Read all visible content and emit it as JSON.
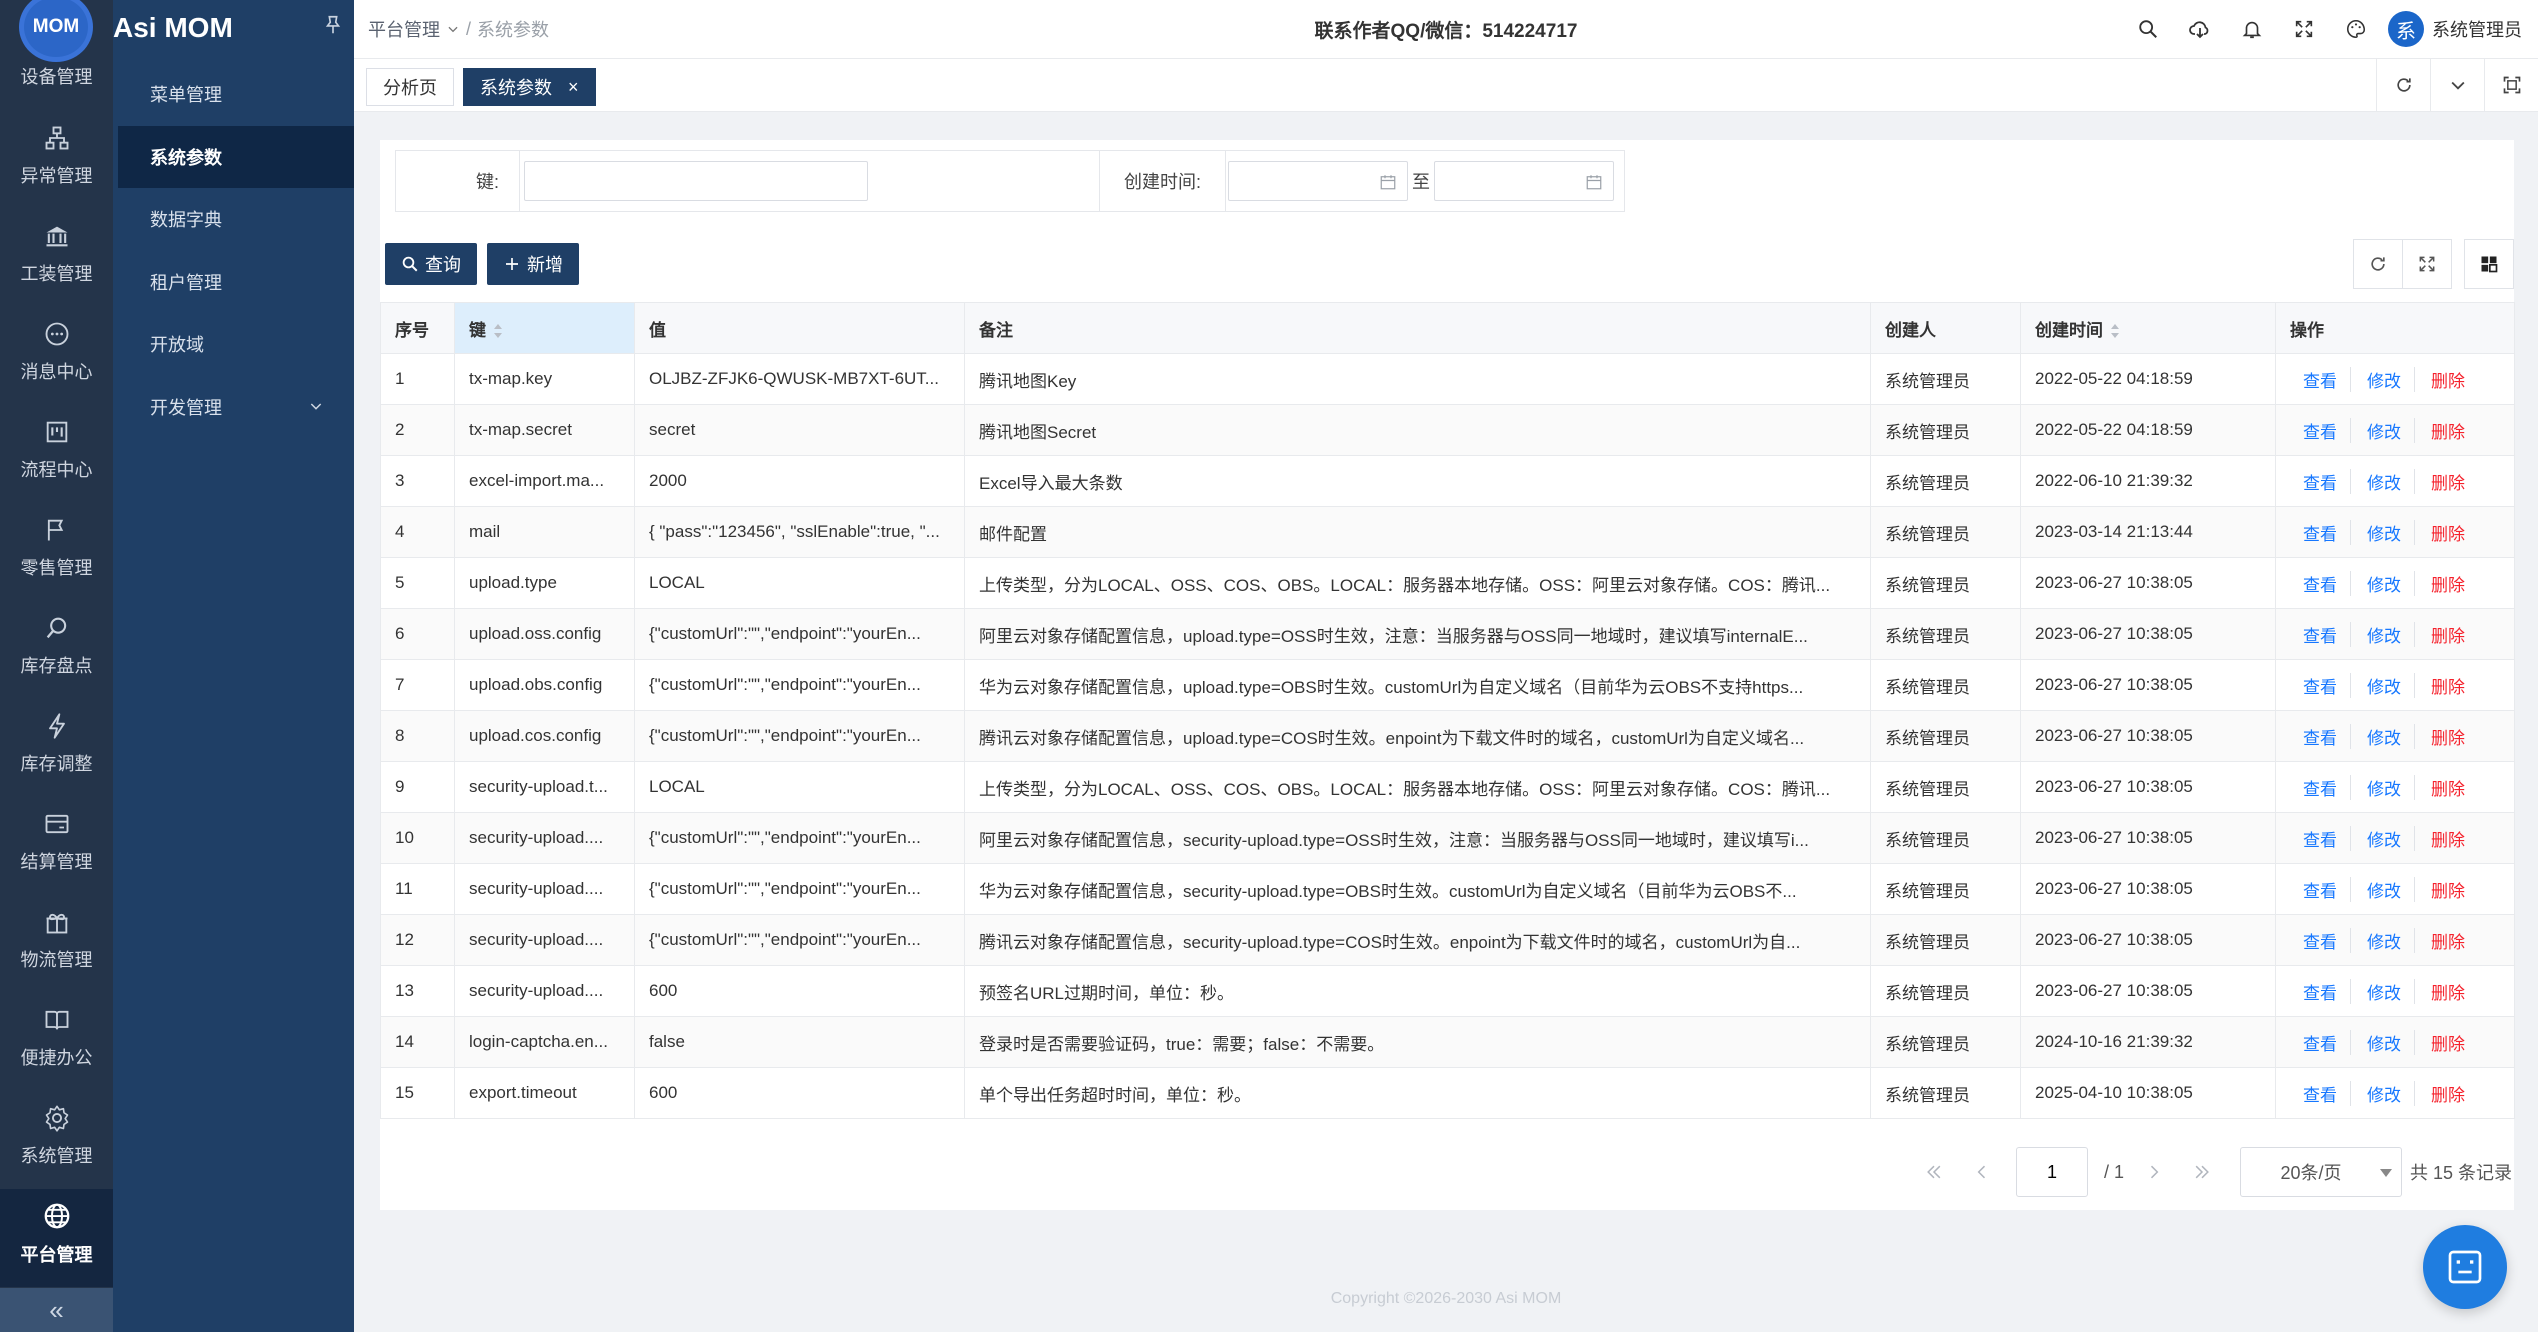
{
  "app": {
    "logo_text": "MOM",
    "title": "Asi MOM"
  },
  "rail": {
    "items": [
      {
        "label": "设备管理",
        "icon": "device-icon"
      },
      {
        "label": "异常管理",
        "icon": "sitemap-icon"
      },
      {
        "label": "工装管理",
        "icon": "bank-icon"
      },
      {
        "label": "消息中心",
        "icon": "message-icon"
      },
      {
        "label": "流程中心",
        "icon": "kanban-icon"
      },
      {
        "label": "零售管理",
        "icon": "flag-icon"
      },
      {
        "label": "库存盘点",
        "icon": "search-icon"
      },
      {
        "label": "库存调整",
        "icon": "lightning-icon"
      },
      {
        "label": "结算管理",
        "icon": "card-icon"
      },
      {
        "label": "物流管理",
        "icon": "gift-icon"
      },
      {
        "label": "便捷办公",
        "icon": "book-icon"
      },
      {
        "label": "系统管理",
        "icon": "gear-icon"
      },
      {
        "label": "平台管理",
        "icon": "globe-icon"
      }
    ],
    "collapse": "«"
  },
  "submenu": {
    "items": [
      {
        "label": "菜单管理"
      },
      {
        "label": "系统参数"
      },
      {
        "label": "数据字典"
      },
      {
        "label": "租户管理"
      },
      {
        "label": "开放域"
      },
      {
        "label": "开发管理"
      }
    ]
  },
  "header": {
    "crumb1": "平台管理",
    "crumb2": "系统参数",
    "notice": "联系作者QQ/微信：514224717",
    "user": "系统管理员",
    "avatar": "系"
  },
  "tabs": [
    {
      "label": "分析页"
    },
    {
      "label": "系统参数",
      "close": "×"
    }
  ],
  "search": {
    "key_label": "键:",
    "key_value": "",
    "time_label": "创建时间:",
    "to": "至"
  },
  "toolbar": {
    "query": "查询",
    "add": "新增"
  },
  "table": {
    "columns": [
      "序号",
      "键",
      "值",
      "备注",
      "创建人",
      "创建时间",
      "操作"
    ],
    "actions": [
      "查看",
      "修改",
      "删除"
    ],
    "rows": [
      [
        "1",
        "tx-map.key",
        "OLJBZ-ZFJK6-QWUSK-MB7XT-6UT...",
        "腾讯地图Key",
        "系统管理员",
        "2022-05-22 04:18:59"
      ],
      [
        "2",
        "tx-map.secret",
        "secret",
        "腾讯地图Secret",
        "系统管理员",
        "2022-05-22 04:18:59"
      ],
      [
        "3",
        "excel-import.ma...",
        "2000",
        "Excel导入最大条数",
        "系统管理员",
        "2022-06-10 21:39:32"
      ],
      [
        "4",
        "mail",
        "{ \"pass\":\"123456\", \"sslEnable\":true, \"...",
        "邮件配置",
        "系统管理员",
        "2023-03-14 21:13:44"
      ],
      [
        "5",
        "upload.type",
        "LOCAL",
        "上传类型，分为LOCAL、OSS、COS、OBS。LOCAL：服务器本地存储。OSS：阿里云对象存储。COS：腾讯...",
        "系统管理员",
        "2023-06-27 10:38:05"
      ],
      [
        "6",
        "upload.oss.config",
        "{\"customUrl\":\"\",\"endpoint\":\"yourEn...",
        "阿里云对象存储配置信息，upload.type=OSS时生效，注意：当服务器与OSS同一地域时，建议填写internalE...",
        "系统管理员",
        "2023-06-27 10:38:05"
      ],
      [
        "7",
        "upload.obs.config",
        "{\"customUrl\":\"\",\"endpoint\":\"yourEn...",
        "华为云对象存储配置信息，upload.type=OBS时生效。customUrl为自定义域名（目前华为云OBS不支持https...",
        "系统管理员",
        "2023-06-27 10:38:05"
      ],
      [
        "8",
        "upload.cos.config",
        "{\"customUrl\":\"\",\"endpoint\":\"yourEn...",
        "腾讯云对象存储配置信息，upload.type=COS时生效。enpoint为下载文件时的域名，customUrl为自定义域名...",
        "系统管理员",
        "2023-06-27 10:38:05"
      ],
      [
        "9",
        "security-upload.t...",
        "LOCAL",
        "上传类型，分为LOCAL、OSS、COS、OBS。LOCAL：服务器本地存储。OSS：阿里云对象存储。COS：腾讯...",
        "系统管理员",
        "2023-06-27 10:38:05"
      ],
      [
        "10",
        "security-upload....",
        "{\"customUrl\":\"\",\"endpoint\":\"yourEn...",
        "阿里云对象存储配置信息，security-upload.type=OSS时生效，注意：当服务器与OSS同一地域时，建议填写i...",
        "系统管理员",
        "2023-06-27 10:38:05"
      ],
      [
        "11",
        "security-upload....",
        "{\"customUrl\":\"\",\"endpoint\":\"yourEn...",
        "华为云对象存储配置信息，security-upload.type=OBS时生效。customUrl为自定义域名（目前华为云OBS不...",
        "系统管理员",
        "2023-06-27 10:38:05"
      ],
      [
        "12",
        "security-upload....",
        "{\"customUrl\":\"\",\"endpoint\":\"yourEn...",
        "腾讯云对象存储配置信息，security-upload.type=COS时生效。enpoint为下载文件时的域名，customUrl为自...",
        "系统管理员",
        "2023-06-27 10:38:05"
      ],
      [
        "13",
        "security-upload....",
        "600",
        "预签名URL过期时间，单位：秒。",
        "系统管理员",
        "2023-06-27 10:38:05"
      ],
      [
        "14",
        "login-captcha.en...",
        "false",
        "登录时是否需要验证码，true：需要；false：不需要。",
        "系统管理员",
        "2024-10-16 21:39:32"
      ],
      [
        "15",
        "export.timeout",
        "600",
        "单个导出任务超时时间，单位：秒。",
        "系统管理员",
        "2025-04-10 10:38:05"
      ]
    ]
  },
  "pager": {
    "page": "1",
    "total_pages": "/ 1",
    "page_size": "20条/页",
    "total": "共 15 条记录"
  },
  "footer": "Copyright ©2026-2030 Asi MOM",
  "colors": {
    "primary": "#1f3f66",
    "link": "#1677ff",
    "danger": "#f5222d",
    "rail": "#24344a"
  }
}
